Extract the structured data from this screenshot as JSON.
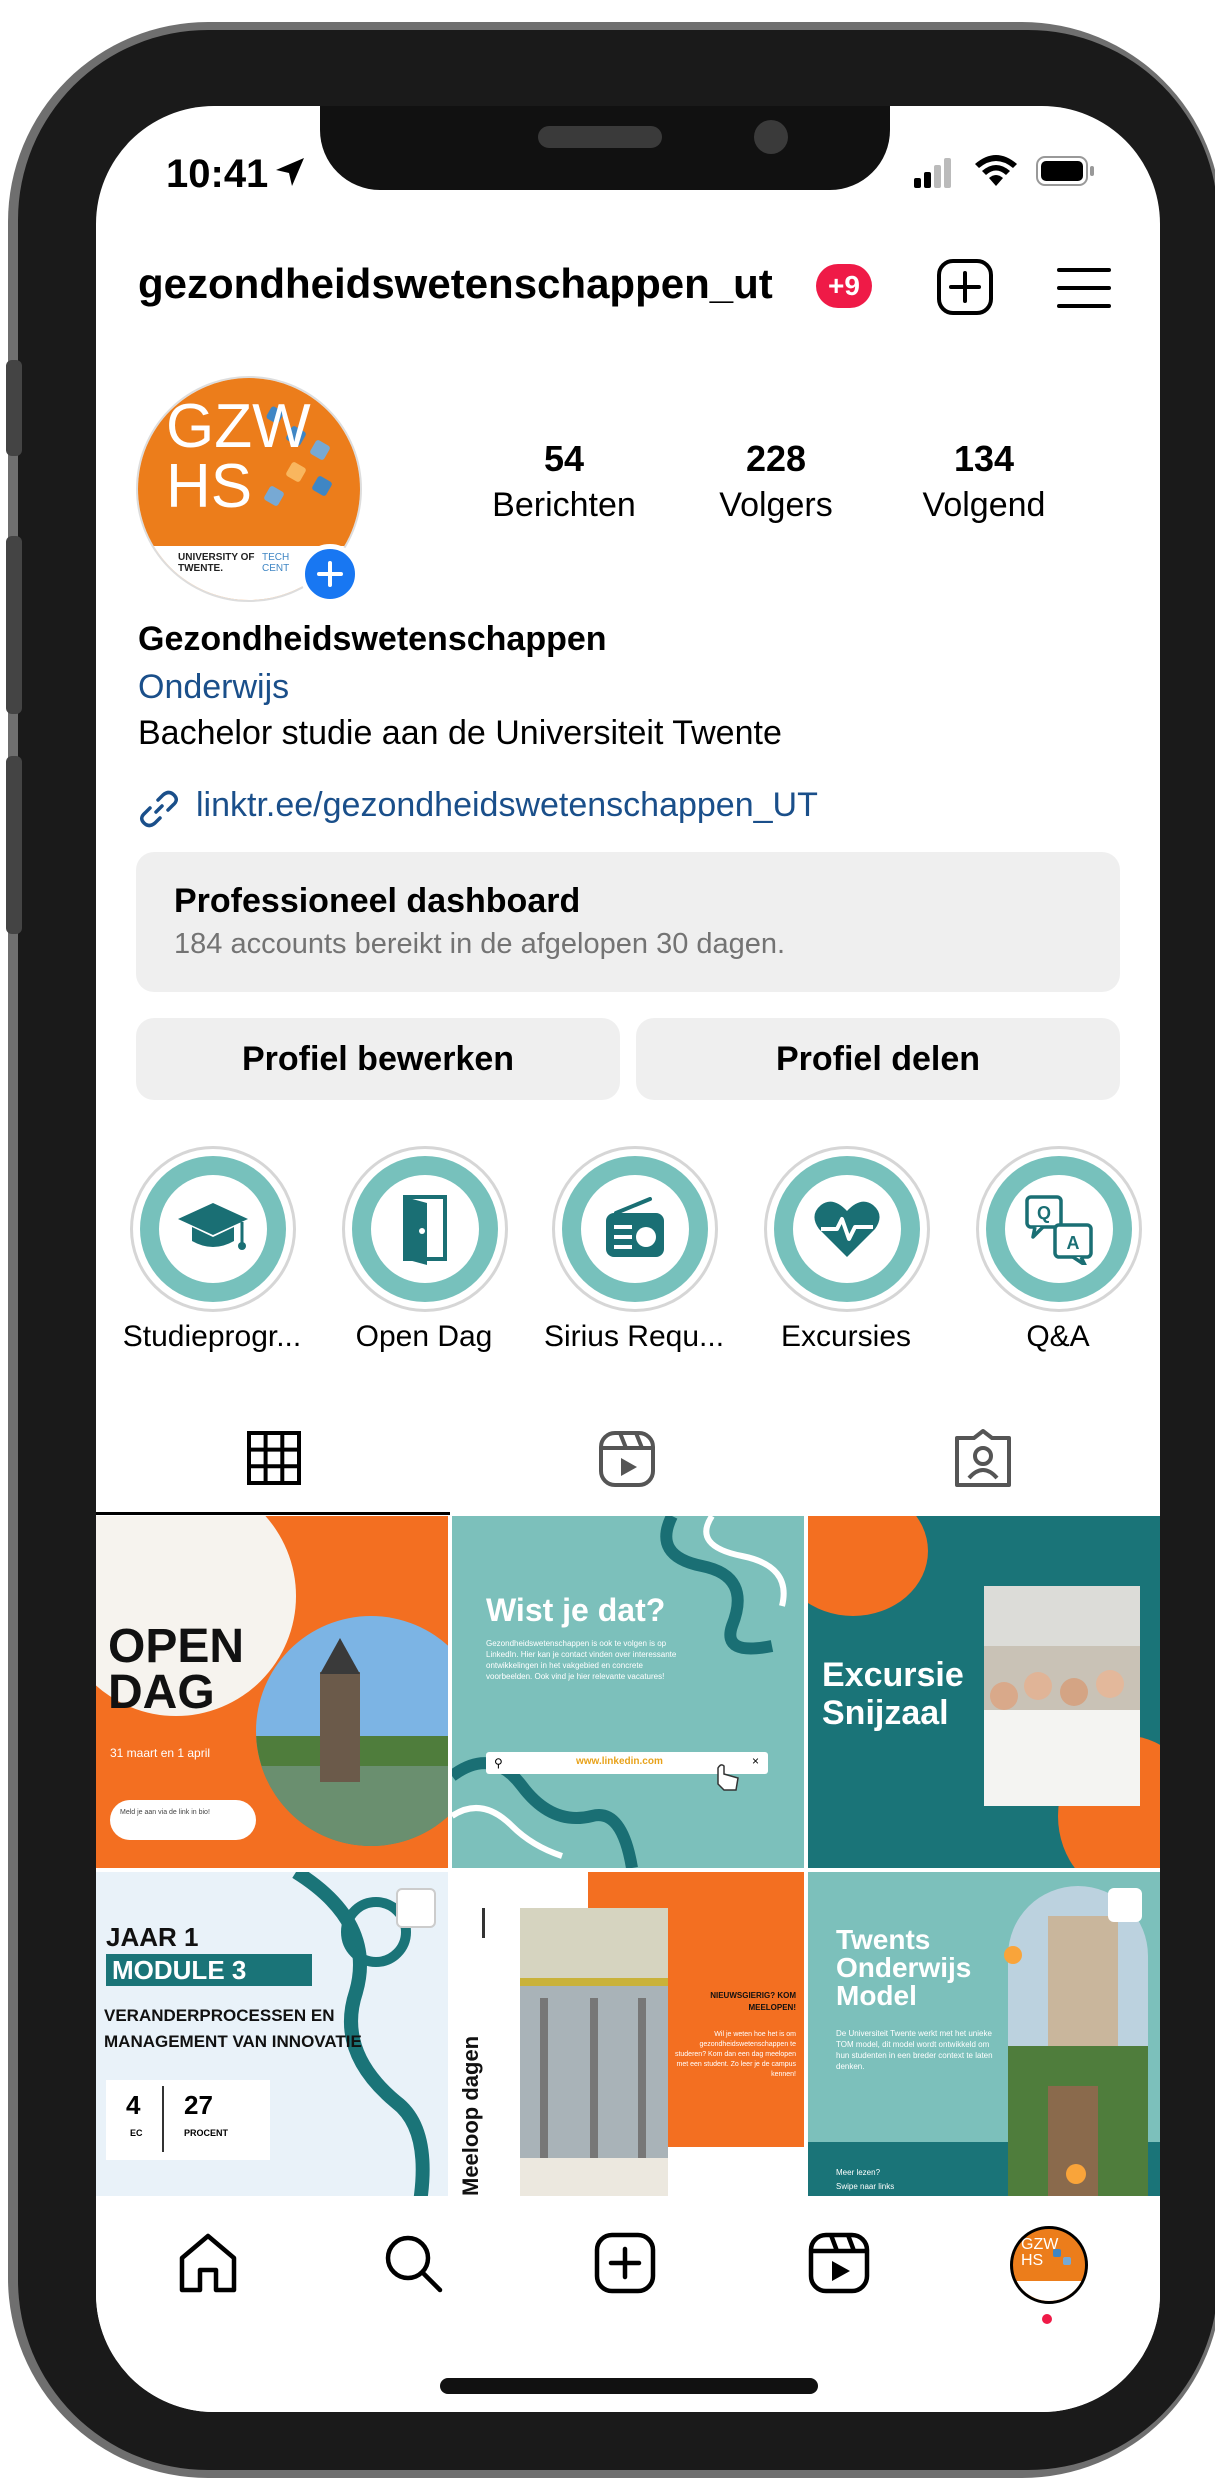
{
  "status_bar": {
    "time": "10:41"
  },
  "header": {
    "username": "gezondheidswetenschappen_ut",
    "notif_badge": "+9"
  },
  "profile": {
    "avatar_text_1": "GZW",
    "avatar_text_2": "HS",
    "avatar_footer_1": "UNIVERSITY OF TWENTE.",
    "avatar_footer_2": "TECH CENT",
    "stats": [
      {
        "value": "54",
        "label": "Berichten"
      },
      {
        "value": "228",
        "label": "Volgers"
      },
      {
        "value": "134",
        "label": "Volgend"
      }
    ],
    "name": "Gezondheidswetenschappen",
    "category": "Onderwijs",
    "bio": "Bachelor studie aan de Universiteit Twente",
    "link": "linktr.ee/gezondheidswetenschappen_UT"
  },
  "dashboard": {
    "title": "Professioneel dashboard",
    "subtitle": "184 accounts bereikt in de afgelopen 30 dagen."
  },
  "buttons": {
    "edit": "Profiel bewerken",
    "share": "Profiel delen"
  },
  "highlights": [
    {
      "label": "Studieprogr...",
      "icon": "graduation-cap-icon"
    },
    {
      "label": "Open Dag",
      "icon": "door-icon"
    },
    {
      "label": "Sirius Requ...",
      "icon": "radio-icon"
    },
    {
      "label": "Excursies",
      "icon": "heart-pulse-icon"
    },
    {
      "label": "Q&A",
      "icon": "qa-chat-icon"
    }
  ],
  "posts": {
    "p1": {
      "line1": "OPEN",
      "line2": "DAG",
      "date": "31 maart en 1 april",
      "cta": "Meld je aan via de link in bio!"
    },
    "p2": {
      "title": "Wist je dat?",
      "body": "Gezondheidswetenschappen is ook te volgen is op LinkedIn. Hier kan je contact vinden over interessante ontwikkelingen in het vakgebied en concrete voorbeelden. Ook vind je hier relevante vacatures!",
      "search": "www.linkedin.com"
    },
    "p3": {
      "title1": "Excursie",
      "title2": "Snijzaal"
    },
    "p4": {
      "l1": "JAAR 1",
      "l2": "MODULE 3",
      "l3": "VERANDERPROCESSEN EN",
      "l4": "MANAGEMENT VAN INNOVATIE",
      "n1": "4",
      "u1": "EC",
      "n2": "27",
      "u2": "PROCENT"
    },
    "p5": {
      "side": "Meeloop dagen",
      "head": "NIEUWSGIERIG? KOM MEELOPEN!",
      "body": "Wil je weten hoe het is om gezondheidswetenschappen te studeren? Kom dan een dag meelopen met een student. Zo leer je de campus kennen!"
    },
    "p6": {
      "t1": "Twents",
      "t2": "Onderwijs",
      "t3": "Model",
      "body": "De Universiteit Twente werkt met het unieke TOM model, dit model wordt ontwikkeld om hun studenten in een breder context te laten denken.",
      "f1": "Meer lezen?",
      "f2": "Swipe naar links"
    }
  },
  "colors": {
    "orange": "#f36f21",
    "teal": "#1a7478",
    "mint": "#77c1bc",
    "badge": "#ef1a47",
    "link": "#1a4f8a",
    "blue": "#1877f2"
  }
}
